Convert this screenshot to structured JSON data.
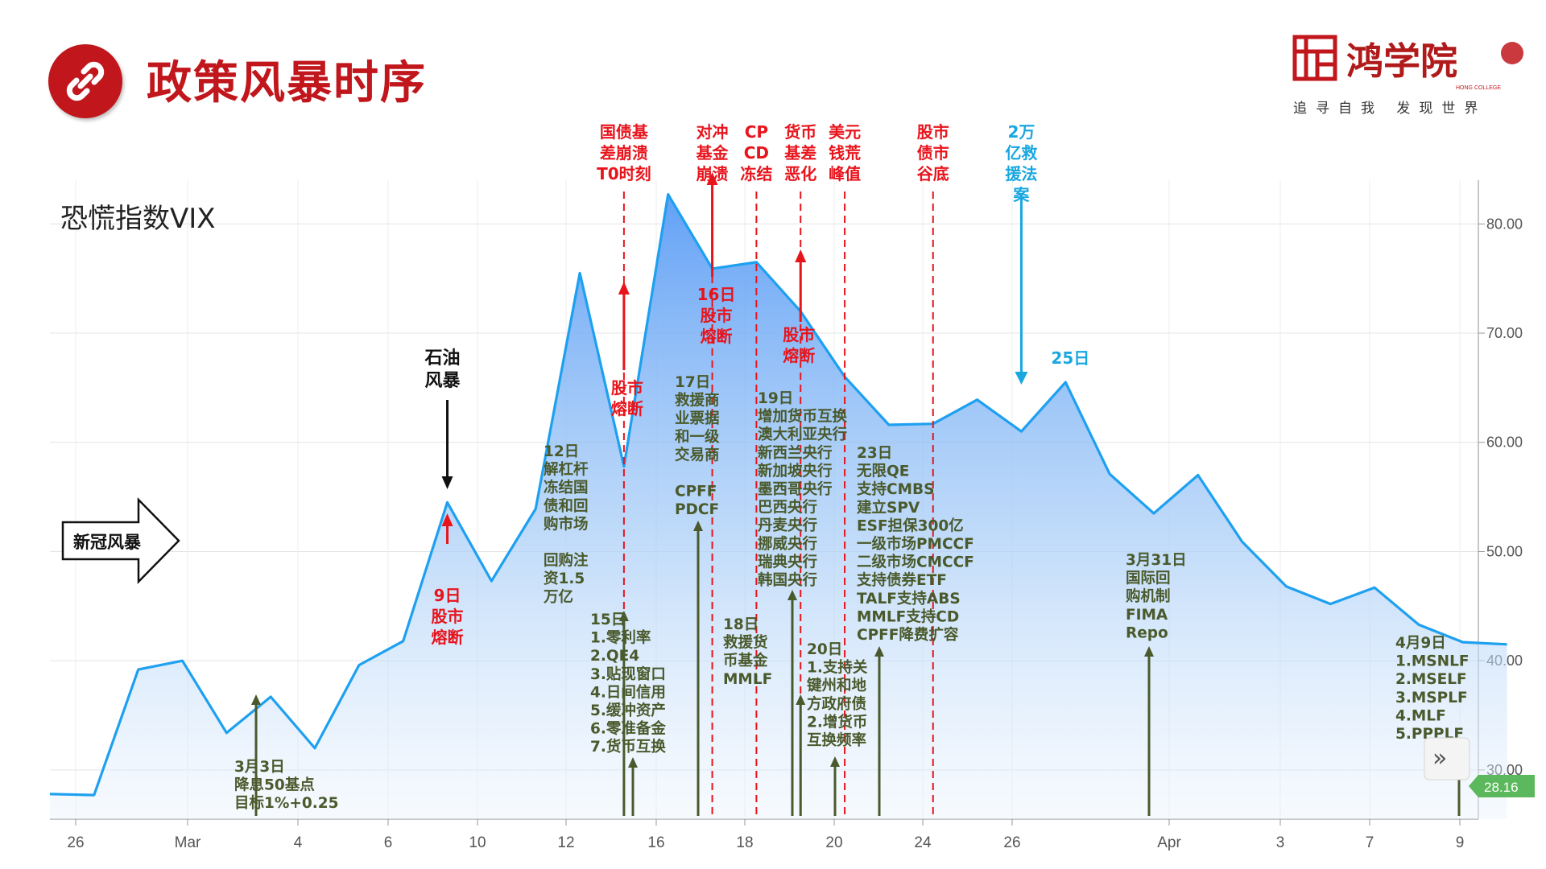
{
  "title": "政策风暴时序",
  "logo": {
    "name": "鸿学院",
    "english": "HONG COLLEGE",
    "tagline": "追寻自我 发现世界"
  },
  "colors": {
    "brand_red": "#c0161c",
    "line_blue": "#1ea0f0",
    "policy_green": "#4a5a2c",
    "crash_red": "#e8141c",
    "rescue_blue": "#19a7e0",
    "last_value_badge": "#5cb85c"
  },
  "chart_data": {
    "type": "area",
    "title": "恐慌指数VIX",
    "x_tick_labels": [
      "26",
      "Mar",
      "4",
      "6",
      "10",
      "12",
      "16",
      "18",
      "20",
      "24",
      "26",
      "Apr",
      "3",
      "7",
      "9"
    ],
    "y_tick_labels": [
      "30.00",
      "40.00",
      "50.00",
      "60.00",
      "70.00",
      "80.00"
    ],
    "ylim": [
      25.5,
      84
    ],
    "last_value_label": "28.16",
    "series": [
      {
        "x": [
          "2020-02-24",
          "2020-02-25",
          "2020-02-26",
          "2020-02-27",
          "2020-02-28",
          "2020-03-02",
          "2020-03-03",
          "2020-03-04",
          "2020-03-05",
          "2020-03-06",
          "2020-03-09",
          "2020-03-10",
          "2020-03-11",
          "2020-03-12",
          "2020-03-13",
          "2020-03-16",
          "2020-03-17",
          "2020-03-18",
          "2020-03-19",
          "2020-03-20",
          "2020-03-23",
          "2020-03-24",
          "2020-03-25",
          "2020-03-26",
          "2020-03-27",
          "2020-03-30",
          "2020-03-31",
          "2020-04-01",
          "2020-04-02",
          "2020-04-03",
          "2020-04-06",
          "2020-04-07",
          "2020-04-08",
          "2020-04-09"
        ],
        "values": [
          27.8,
          27.7,
          39.2,
          40.0,
          33.4,
          36.7,
          32.0,
          39.6,
          41.8,
          54.5,
          47.3,
          53.9,
          75.5,
          57.8,
          82.7,
          75.9,
          76.5,
          72.0,
          66.0,
          61.6,
          61.7,
          63.9,
          61.0,
          65.5,
          57.1,
          53.5,
          57.0,
          50.9,
          46.8,
          45.2,
          46.7,
          43.3,
          41.7,
          41.5
        ]
      }
    ],
    "annotations": {
      "covid": "新冠风暴",
      "oil": "石油\n风暴",
      "crash_9": "9日\n股市\n熔断",
      "crash_12": "股市\n熔断",
      "crash_16": "16日\n股市\n熔断",
      "crash_18": "股市\n熔断",
      "top_events": [
        {
          "date": "2020-03-12",
          "text": "国债基\n差崩溃\nT0时刻",
          "color": "red"
        },
        {
          "date": "2020-03-16",
          "text": "对冲\n基金\n崩溃",
          "color": "red"
        },
        {
          "date": "2020-03-17",
          "text": "CP\nCD\n冻结",
          "color": "red"
        },
        {
          "date": "2020-03-18",
          "text": "货币\n基差\n恶化",
          "color": "red"
        },
        {
          "date": "2020-03-19",
          "text": "美元\n钱荒\n峰值",
          "color": "red"
        },
        {
          "date": "2020-03-23",
          "text": "股市\n债市\n谷底",
          "color": "red"
        },
        {
          "date": "2020-03-25",
          "text": "2万\n亿救\n援法\n案",
          "color": "blue"
        }
      ],
      "rescue_day": "25日",
      "policies": [
        {
          "date": "2020-03-03",
          "text": "3月3日\n降息50基点\n目标1%+0.25"
        },
        {
          "date": "2020-03-12",
          "text": "12日\n解杠杆\n冻结国\n债和回\n购市场\n\n回购注\n资1.5\n万亿"
        },
        {
          "date": "2020-03-15",
          "text": "15日\n1.零利率\n2.QE4\n3.贴现窗口\n4.日间信用\n5.缓冲资产\n6.零准备金\n7.货币互换"
        },
        {
          "date": "2020-03-17",
          "text": "17日\n救援商\n业票据\n和一级\n交易商\n\nCPFF\nPDCF"
        },
        {
          "date": "2020-03-18",
          "text": "18日\n救援货\n币基金\nMMLF"
        },
        {
          "date": "2020-03-19",
          "text": "19日\n增加货币互换\n澳大利亚央行\n新西兰央行\n新加坡央行\n墨西哥央行\n巴西央行\n丹麦央行\n挪威央行\n瑞典央行\n韩国央行"
        },
        {
          "date": "2020-03-20",
          "text": "20日\n1.支持关\n键州和地\n方政府债\n2.增货币\n互换频率"
        },
        {
          "date": "2020-03-23",
          "text": "23日\n无限QE\n支持CMBS\n建立SPV\nESF担保300亿\n一级市场PMCCF\n二级市场CMCCF\n支持债券ETF\nTALF支持ABS\nMMLF支持CD\nCPFF降费扩容"
        },
        {
          "date": "2020-03-31",
          "text": "3月31日\n国际回\n购机制\nFIMA\nRepo"
        },
        {
          "date": "2020-04-09",
          "text": "4月9日\n1.MSNLF\n2.MSELF\n3.MSPLF\n4.MLF\n5.PPPLF"
        }
      ]
    }
  }
}
